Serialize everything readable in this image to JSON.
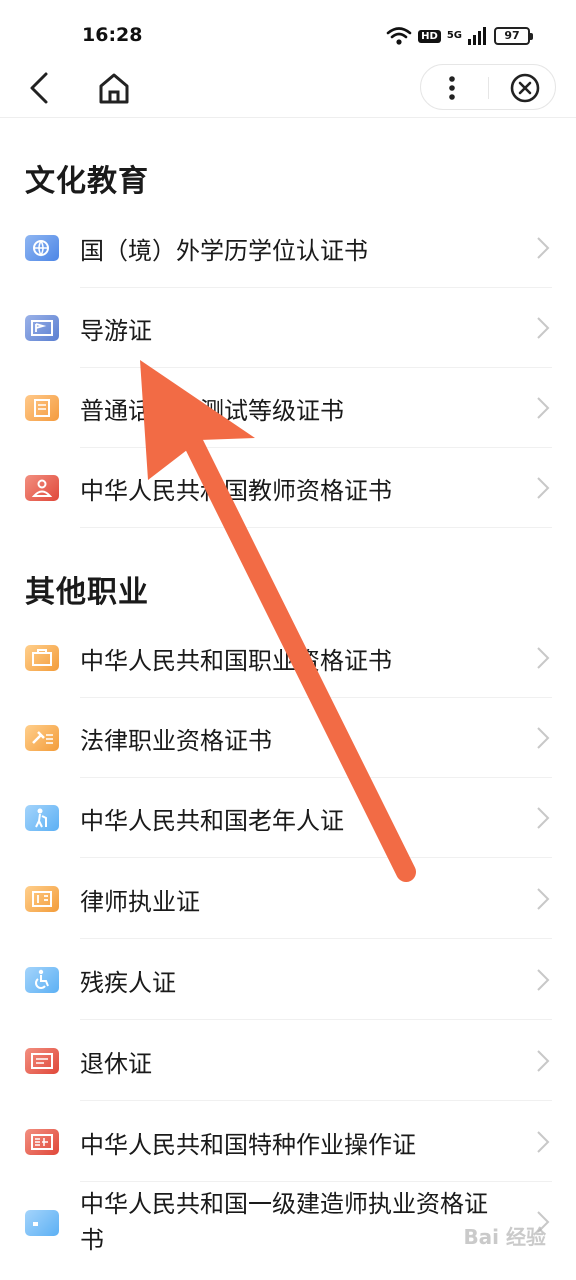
{
  "status_bar": {
    "time": "16:28",
    "hd": "HD",
    "network": "5G",
    "battery": "97"
  },
  "nav": {
    "back_icon": "chevron-left-icon",
    "home_icon": "home-icon",
    "more_icon": "more-vertical-icon",
    "close_icon": "close-circle-icon"
  },
  "sections": [
    {
      "title": "文化教育",
      "items": [
        {
          "label": "国（境）外学历学位认证书",
          "icon": "globe-certificate-icon",
          "color": "#5b8fe8"
        },
        {
          "label": "导游证",
          "icon": "flag-card-icon",
          "color": "#5a7fd1"
        },
        {
          "label": "普通话水平测试等级证书",
          "icon": "document-icon",
          "color": "#f39c3a"
        },
        {
          "label": "中华人民共和国教师资格证书",
          "icon": "teacher-icon",
          "color": "#e0483a"
        }
      ]
    },
    {
      "title": "其他职业",
      "items": [
        {
          "label": "中华人民共和国职业资格证书",
          "icon": "briefcase-icon",
          "color": "#f39c3a"
        },
        {
          "label": "法律职业资格证书",
          "icon": "gavel-icon",
          "color": "#f39c3a"
        },
        {
          "label": "中华人民共和国老年人证",
          "icon": "elderly-icon",
          "color": "#5cb0f4"
        },
        {
          "label": "律师执业证",
          "icon": "lawyer-card-icon",
          "color": "#f39c3a"
        },
        {
          "label": "残疾人证",
          "icon": "wheelchair-icon",
          "color": "#5cb0f4"
        },
        {
          "label": "退休证",
          "icon": "retire-card-icon",
          "color": "#e0483a"
        },
        {
          "label": "中华人民共和国特种作业操作证",
          "icon": "special-ops-icon",
          "color": "#e0483a"
        },
        {
          "label": "中华人民共和国一级建造师执业资格证书",
          "icon": "card-icon",
          "color": "#5cb0f4"
        }
      ]
    }
  ],
  "watermark": "Bai 经验"
}
